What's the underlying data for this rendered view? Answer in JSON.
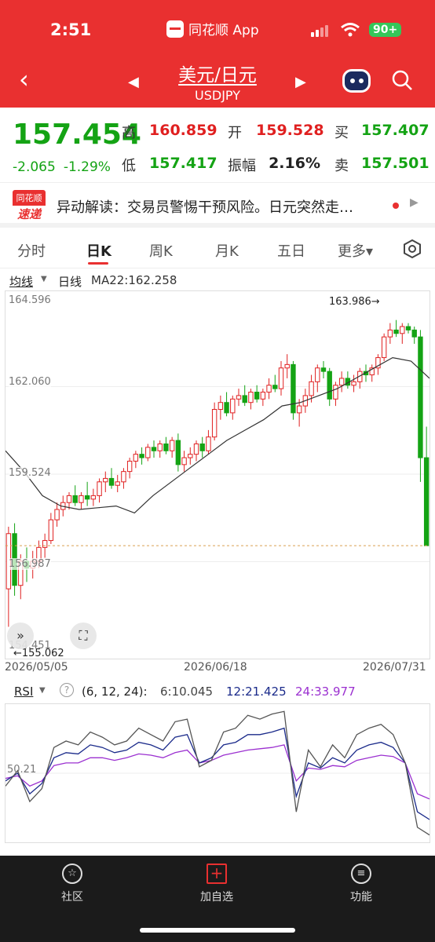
{
  "status": {
    "time": "2:51",
    "app": "同花顺 App",
    "battery": "90+"
  },
  "nav": {
    "back_icon": "chevron-left-icon",
    "pair_name": "美元/日元",
    "pair_symbol": "USDJPY"
  },
  "quote": {
    "price": "157.454",
    "change": "-2.065",
    "change_pct": "-1.29%",
    "high_label": "高",
    "high": "160.859",
    "low_label": "低",
    "low": "157.417",
    "open_label": "开",
    "open": "159.528",
    "amp_label": "振幅",
    "amp": "2.16%",
    "buy_label": "买",
    "buy": "157.407",
    "sell_label": "卖",
    "sell": "157.501"
  },
  "news": {
    "logo_top": "同花顺",
    "logo_bottom": "速递",
    "text": "异动解读：交易员警惕干预风险。日元突然走…"
  },
  "tabs": [
    "分时",
    "日K",
    "周K",
    "月K",
    "五日",
    "更多▾"
  ],
  "indicator_bar": {
    "ma_label": "均线",
    "type_label": "日线",
    "ma_value": "MA22:162.258"
  },
  "chart_labels": {
    "y_ticks": [
      "164.596",
      "162.060",
      "159.524",
      "156.987",
      "154.451"
    ],
    "high_annotation": "163.986→",
    "low_annotation": "←155.062",
    "dates": [
      "2026/05/05",
      "2026/06/18",
      "2026/07/31"
    ]
  },
  "rsi": {
    "label": "RSI",
    "params": "(6, 12, 24):",
    "r6": "6:10.045",
    "r12": "12:21.425",
    "r24": "24:33.977",
    "ref_level": "50.21"
  },
  "bottom_nav": [
    {
      "label": "社区"
    },
    {
      "label": "加自选"
    },
    {
      "label": "功能"
    }
  ],
  "colors": {
    "up": "#e02020",
    "down": "#14a314",
    "header": "#e93030",
    "ma": "#333333",
    "rsi6": "#555555",
    "rsi12": "#1a2a8a",
    "rsi24": "#9b30d0"
  },
  "chart_data": {
    "type": "candlestick",
    "y_range": [
      154.451,
      164.596
    ],
    "candles": [
      [
        156.2,
        158.0,
        155.1,
        157.8
      ],
      [
        157.8,
        158.1,
        156.0,
        156.3
      ],
      [
        156.3,
        157.2,
        155.9,
        157.0
      ],
      [
        157.0,
        157.4,
        156.4,
        156.8
      ],
      [
        156.8,
        157.3,
        156.5,
        157.0
      ],
      [
        157.0,
        157.6,
        156.8,
        157.4
      ],
      [
        157.4,
        157.8,
        157.1,
        157.6
      ],
      [
        157.6,
        158.4,
        157.5,
        158.2
      ],
      [
        158.2,
        158.7,
        158.0,
        158.5
      ],
      [
        158.5,
        158.9,
        158.3,
        158.7
      ],
      [
        158.7,
        159.0,
        158.5,
        158.9
      ],
      [
        158.9,
        159.2,
        158.6,
        158.7
      ],
      [
        158.7,
        159.0,
        158.5,
        158.9
      ],
      [
        158.9,
        159.3,
        158.6,
        158.8
      ],
      [
        158.8,
        159.1,
        158.6,
        158.9
      ],
      [
        158.9,
        159.4,
        158.7,
        159.3
      ],
      [
        159.3,
        159.6,
        159.0,
        159.4
      ],
      [
        159.4,
        159.7,
        159.1,
        159.2
      ],
      [
        159.2,
        159.5,
        159.0,
        159.3
      ],
      [
        159.3,
        159.7,
        159.1,
        159.6
      ],
      [
        159.6,
        160.0,
        159.4,
        159.9
      ],
      [
        159.9,
        160.2,
        159.7,
        160.1
      ],
      [
        160.1,
        160.3,
        159.8,
        160.0
      ],
      [
        160.0,
        160.4,
        159.9,
        160.3
      ],
      [
        160.3,
        160.5,
        160.0,
        160.2
      ],
      [
        160.2,
        160.5,
        160.0,
        160.4
      ],
      [
        160.4,
        160.6,
        160.1,
        160.2
      ],
      [
        160.2,
        160.6,
        160.0,
        160.5
      ],
      [
        160.5,
        160.7,
        159.6,
        159.8
      ],
      [
        159.8,
        160.2,
        159.6,
        160.0
      ],
      [
        160.0,
        160.3,
        159.8,
        160.1
      ],
      [
        160.1,
        160.5,
        159.9,
        160.4
      ],
      [
        160.4,
        160.6,
        160.0,
        160.2
      ],
      [
        160.2,
        160.8,
        160.1,
        160.6
      ],
      [
        160.6,
        161.6,
        160.5,
        161.4
      ],
      [
        161.4,
        161.8,
        161.1,
        161.6
      ],
      [
        161.6,
        161.9,
        161.2,
        161.3
      ],
      [
        161.3,
        161.8,
        161.1,
        161.7
      ],
      [
        161.7,
        162.0,
        161.5,
        161.8
      ],
      [
        161.8,
        162.1,
        161.5,
        161.6
      ],
      [
        161.6,
        162.0,
        161.4,
        161.9
      ],
      [
        161.9,
        162.1,
        161.6,
        161.7
      ],
      [
        161.7,
        162.0,
        161.5,
        161.9
      ],
      [
        161.9,
        162.3,
        161.7,
        162.1
      ],
      [
        162.1,
        162.4,
        161.9,
        162.0
      ],
      [
        162.0,
        162.8,
        161.8,
        162.6
      ],
      [
        162.6,
        163.0,
        162.3,
        162.7
      ],
      [
        162.7,
        162.8,
        161.1,
        161.3
      ],
      [
        161.3,
        161.7,
        160.9,
        161.5
      ],
      [
        161.5,
        162.0,
        161.3,
        161.8
      ],
      [
        161.8,
        162.4,
        161.6,
        162.2
      ],
      [
        162.2,
        162.7,
        161.9,
        162.6
      ],
      [
        162.6,
        162.8,
        162.3,
        162.5
      ],
      [
        162.5,
        162.6,
        161.5,
        161.7
      ],
      [
        161.7,
        162.2,
        161.5,
        162.1
      ],
      [
        162.1,
        162.5,
        161.9,
        162.3
      ],
      [
        162.3,
        162.5,
        162.0,
        162.1
      ],
      [
        162.1,
        162.4,
        161.9,
        162.2
      ],
      [
        162.2,
        162.6,
        162.0,
        162.5
      ],
      [
        162.5,
        162.7,
        162.2,
        162.4
      ],
      [
        162.4,
        162.7,
        162.2,
        162.6
      ],
      [
        162.6,
        163.0,
        162.4,
        162.9
      ],
      [
        162.9,
        163.6,
        162.8,
        163.5
      ],
      [
        163.5,
        163.9,
        163.3,
        163.7
      ],
      [
        163.7,
        163.99,
        163.5,
        163.6
      ],
      [
        163.6,
        163.9,
        163.3,
        163.8
      ],
      [
        163.8,
        163.9,
        163.6,
        163.7
      ],
      [
        163.7,
        163.8,
        163.3,
        163.5
      ],
      [
        163.5,
        163.7,
        159.3,
        160.0
      ],
      [
        160.0,
        160.9,
        157.8,
        157.45
      ]
    ],
    "ma22_points": [
      160.2,
      159.6,
      158.9,
      158.6,
      158.5,
      158.55,
      158.6,
      158.4,
      158.9,
      159.3,
      159.7,
      160.1,
      160.5,
      160.8,
      161.1,
      161.5,
      161.6,
      161.8,
      162.0,
      162.3,
      162.6,
      162.9,
      162.8,
      162.3
    ],
    "rsi6": [
      40,
      52,
      28,
      38,
      70,
      75,
      72,
      82,
      78,
      72,
      75,
      85,
      80,
      75,
      90,
      92,
      55,
      60,
      82,
      85,
      95,
      92,
      96,
      98,
      20,
      68,
      55,
      72,
      62,
      80,
      85,
      88,
      80,
      58,
      8,
      2
    ],
    "rsi12": [
      44,
      50,
      34,
      42,
      62,
      66,
      65,
      72,
      70,
      66,
      68,
      74,
      72,
      68,
      78,
      80,
      58,
      62,
      72,
      74,
      80,
      80,
      82,
      85,
      32,
      58,
      54,
      62,
      58,
      68,
      72,
      74,
      70,
      58,
      20,
      14
    ],
    "rsi24": [
      46,
      48,
      40,
      44,
      56,
      58,
      58,
      62,
      62,
      60,
      62,
      65,
      64,
      62,
      66,
      68,
      58,
      60,
      64,
      66,
      68,
      69,
      70,
      72,
      44,
      54,
      53,
      56,
      55,
      60,
      62,
      64,
      63,
      58,
      34,
      30
    ]
  }
}
